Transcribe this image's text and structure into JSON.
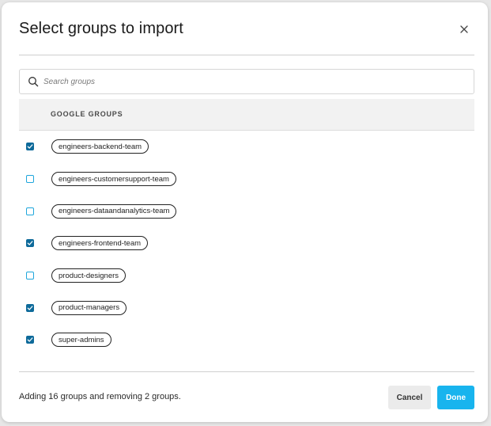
{
  "dialog": {
    "title": "Select groups to import",
    "close_icon": "close-icon"
  },
  "search": {
    "placeholder": "Search groups",
    "value": "",
    "icon": "search-icon"
  },
  "table": {
    "column_header": "GOOGLE GROUPS",
    "rows": [
      {
        "name": "engineers-backend-team",
        "checked": true
      },
      {
        "name": "engineers-customersupport-team",
        "checked": false
      },
      {
        "name": "engineers-dataandanalytics-team",
        "checked": false
      },
      {
        "name": "engineers-frontend-team",
        "checked": true
      },
      {
        "name": "product-designers",
        "checked": false
      },
      {
        "name": "product-managers",
        "checked": true
      },
      {
        "name": "super-admins",
        "checked": true
      }
    ]
  },
  "footer": {
    "summary": "Adding 16 groups and removing 2 groups.",
    "cancel_label": "Cancel",
    "done_label": "Done"
  },
  "colors": {
    "checked": "#0e6a9a",
    "unchecked_border": "#1ea6dc",
    "primary": "#18b4ee"
  }
}
